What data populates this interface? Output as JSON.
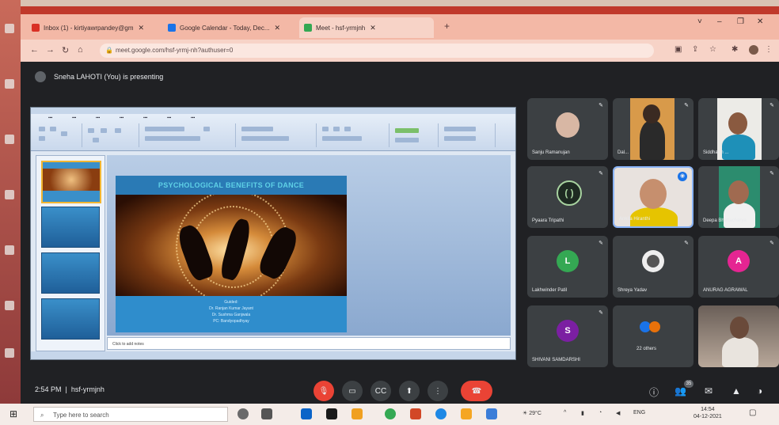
{
  "browser": {
    "tabs": [
      {
        "label": "Inbox (1) - kirtiyawrpandey@gm",
        "color": "#d93025"
      },
      {
        "label": "Google Calendar - Today, Dec...",
        "color": "#1a73e8"
      },
      {
        "label": "Meet - hsf-yrmjnh",
        "color": "#34a853"
      }
    ],
    "url": "meet.google.com/hsf-yrmj-nh?authuser=0",
    "window_controls": [
      "˅",
      "–",
      "❐",
      "✕"
    ]
  },
  "meet": {
    "presenting_text": "Sneha LAHOTI (You) is presenting",
    "slide": {
      "title": "PSYCHOLOGICAL BENEFITS OF DANCE",
      "credit_lines": [
        "Guided:",
        "Dr. Ranjan Kumar Jayant",
        "Dr. Sushma Ganjwala",
        "PC: Bandyopadhyay"
      ],
      "notes_placeholder": "Click to add notes"
    },
    "participants": [
      {
        "name": "Sanju Ramanujan",
        "type": "video-avatar"
      },
      {
        "name": "Dal...",
        "type": "video"
      },
      {
        "name": "Siddharth ...",
        "type": "video"
      },
      {
        "name": "Pyaara Tripathi",
        "type": "icon"
      },
      {
        "name": "Ankita Hiranthi",
        "type": "video",
        "speaking": true
      },
      {
        "name": "Deepa Bhattacharya",
        "type": "video"
      },
      {
        "name": "Lakhwinder Patil",
        "type": "letter",
        "letter": "L",
        "color": "#34a853"
      },
      {
        "name": "Shreya Yadav",
        "type": "photo"
      },
      {
        "name": "ANURAG AGRAWAL",
        "type": "letter",
        "letter": "A",
        "color": "#e52592"
      },
      {
        "name": "SHIVANI SAMDARSHI",
        "type": "letter",
        "letter": "S",
        "color": "#7b1fa2"
      },
      {
        "name": "22 others",
        "type": "others"
      },
      {
        "name": "",
        "type": "video"
      }
    ],
    "time": "2:54 PM",
    "meeting_code": "hsf-yrmjnh",
    "controls": [
      "mic-off",
      "camera",
      "captions",
      "present",
      "more",
      "end-call"
    ],
    "right_icons": [
      "info-icon",
      "people-icon",
      "chat-icon",
      "activities-icon",
      "lock-icon"
    ],
    "people_badge": "35"
  },
  "taskbar": {
    "search_placeholder": "Type here to search",
    "weather": "29°C",
    "time": "14:54",
    "date": "04-12-2021"
  }
}
